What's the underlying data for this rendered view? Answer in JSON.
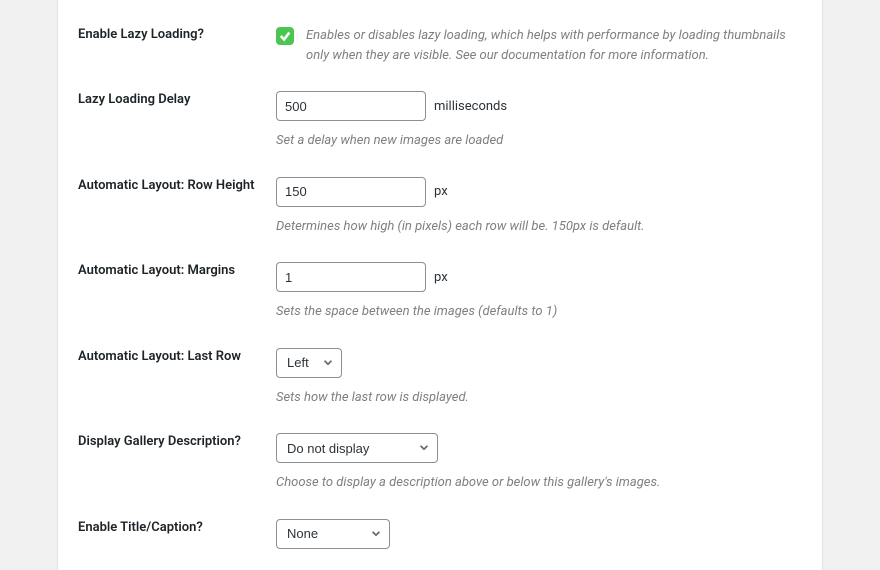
{
  "sections": {
    "lazy_loading": {
      "label": "Enable Lazy Loading?",
      "desc": "Enables or disables lazy loading, which helps with performance by loading thumbnails only when they are visible. See our documentation for more information."
    },
    "lazy_delay": {
      "label": "Lazy Loading Delay",
      "value": "500",
      "unit": "milliseconds",
      "desc": "Set a delay when new images are loaded"
    },
    "row_height": {
      "label": "Automatic Layout: Row Height",
      "value": "150",
      "unit": "px",
      "desc": "Determines how high (in pixels) each row will be. 150px is default."
    },
    "margins": {
      "label": "Automatic Layout: Margins",
      "value": "1",
      "unit": "px",
      "desc": "Sets the space between the images (defaults to 1)"
    },
    "last_row": {
      "label": "Automatic Layout: Last Row",
      "value": "Left",
      "desc": "Sets how the last row is displayed."
    },
    "gallery_desc": {
      "label": "Display Gallery Description?",
      "value": "Do not display",
      "desc": "Choose to display a description above or below this gallery's images."
    },
    "title_caption": {
      "label": "Enable Title/Caption?",
      "value": "None"
    }
  }
}
